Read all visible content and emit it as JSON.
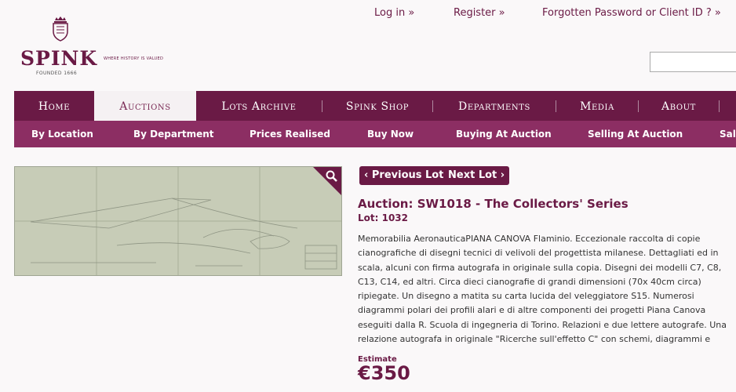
{
  "brand": {
    "name": "SPINK",
    "tagline": "WHERE HISTORY IS VALUED",
    "founded": "FOUNDED 1666"
  },
  "toplinks": {
    "login": "Log in »",
    "register": "Register »",
    "forgotten": "Forgotten Password or Client ID ? »"
  },
  "search": {
    "value": ""
  },
  "mainnav": [
    "Home",
    "Auctions",
    "Lots Archive",
    "Spink Shop",
    "Departments",
    "Media",
    "About"
  ],
  "subnav": [
    "By Location",
    "By Department",
    "Prices Realised",
    "Buy Now",
    "Buying At Auction",
    "Selling At Auction",
    "Sale"
  ],
  "lotnav": {
    "previous": "‹ Previous Lot",
    "next": "Next Lot ›"
  },
  "auction": {
    "title": "Auction: SW1018 - The Collectors' Series",
    "lot": "Lot: 1032"
  },
  "description": "Memorabilia AeronauticaPIANA CANOVA Flaminio. Eccezionale raccolta di copie cianografiche di disegni tecnici di velivoli del progettista milanese. Dettagliati ed in scala, alcuni con firma autografa in originale sulla copia. Disegni dei modelli C7, C8, C13, C14, ed altri. Circa dieci cianografie di grandi dimensioni (70x 40cm circa) ripiegate. Un disegno a matita su carta lucida del veleggiatore S15. Numerosi diagrammi polari dei profili alari e di altre componenti dei progetti Piana Canova eseguiti dalla R. Scuola di ingegneria di Torino. Relazioni e due lettere autografe. Una relazione autografa in originale \"Ricerche sull'effetto C\" con schemi, diagrammi e correzioni autografe. Foto",
  "estimate": {
    "label": "Estimate",
    "value": "€350"
  },
  "colors": {
    "brand": "#6a1a45",
    "subnav": "#8c2e63"
  },
  "icons": {
    "zoom": "magnifier-icon",
    "crest": "crest-icon"
  }
}
